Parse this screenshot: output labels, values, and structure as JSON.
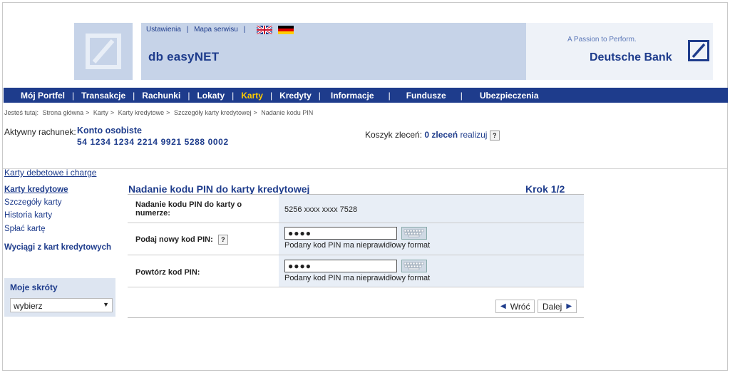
{
  "header": {
    "top_links": [
      "Ustawienia",
      "Mapa serwisu"
    ],
    "app_title": "db easyNET",
    "slogan": "A Passion to Perform.",
    "bank_name": "Deutsche Bank"
  },
  "nav": {
    "items": [
      "Mój Portfel",
      "Transakcje",
      "Rachunki",
      "Lokaty",
      "Karty",
      "Kredyty",
      "Informacje",
      "Fundusze",
      "Ubezpieczenia"
    ],
    "active": "Karty"
  },
  "breadcrumb": {
    "prefix": "Jesteś tutaj:",
    "items": [
      "Strona główna",
      "Karty",
      "Karty kredytowe",
      "Szczegóły karty kredytowej",
      "Nadanie kodu PIN"
    ]
  },
  "account": {
    "label": "Aktywny rachunek:",
    "name": "Konto osobiste",
    "number": "54 1234 1234 2214 9921 5288 0002"
  },
  "basket": {
    "label": "Koszyk zleceń:",
    "count": "0 zleceń",
    "action": "realizuj",
    "help": "?"
  },
  "sidebar": {
    "items": [
      "Karty debetowe i charge",
      "Karty kredytowe",
      "Szczegóły karty",
      "Historia karty",
      "Spłać kartę",
      "Wyciągi z kart kredytowych"
    ],
    "shortcuts_title": "Moje skróty",
    "shortcuts_value": "wybierz"
  },
  "form": {
    "title": "Nadanie kodu PIN do karty kredytowej",
    "step": "Krok 1/2",
    "card_label": "Nadanie kodu PIN do karty o numerze:",
    "card_number": "5256 xxxx xxxx 7528",
    "new_pin_label": "Podaj nowy kod PIN:",
    "new_pin_value": "●●●●",
    "new_pin_error": "Podany kod PIN ma nieprawidłowy format",
    "repeat_pin_label": "Powtórz kod PIN:",
    "repeat_pin_value": "●●●●",
    "repeat_pin_error": "Podany kod PIN ma nieprawidłowy format",
    "help": "?",
    "back_label": "Wróć",
    "next_label": "Dalej"
  },
  "colors": {
    "brand_blue": "#1e3c8c",
    "active_nav": "#ffcc00",
    "panel_blue": "#c6d3e8"
  }
}
